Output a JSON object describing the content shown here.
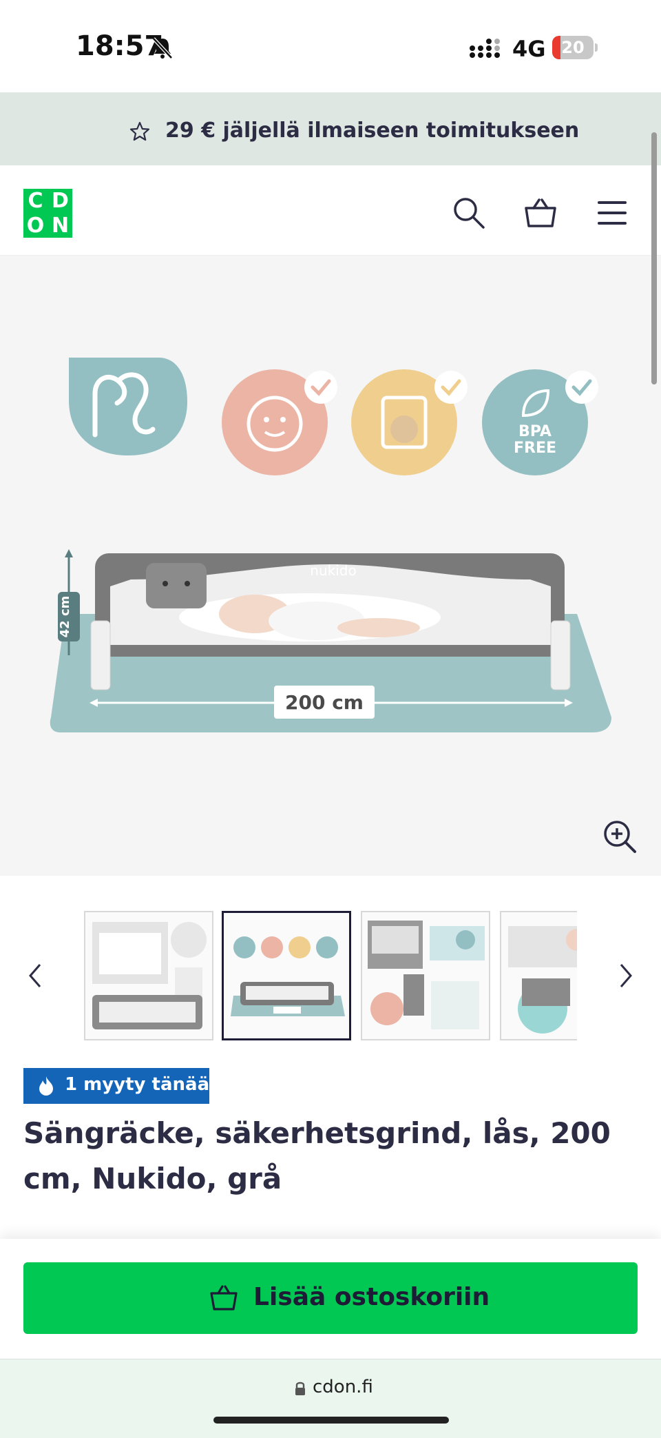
{
  "status_bar": {
    "time": "18:57",
    "network": "4G",
    "battery_level": "20",
    "battery_fraction": 0.2
  },
  "promo_banner": {
    "icon": "star-outline-icon",
    "text": "29 € jäljellä ilmaiseen toimitukseen"
  },
  "header": {
    "logo_letters": [
      "C",
      "D",
      "O",
      "N"
    ],
    "colors": {
      "brand": "#00c853",
      "banner": "#dfe7e2"
    },
    "icons": [
      "search-icon",
      "basket-icon",
      "hamburger-menu-icon"
    ]
  },
  "product_image": {
    "brand": "nukido",
    "height_label": "42 cm",
    "width_label": "200 cm",
    "badge_text_1": "BPA",
    "badge_text_2": "FREE"
  },
  "thumbnails": {
    "selected_index": 1,
    "count_visible": 4
  },
  "badge": {
    "icon": "fire-icon",
    "text": "1 myyty tänään",
    "color": "#1465b8"
  },
  "product": {
    "title": "Sängräcke, säkerhetsgrind, lås, 200 cm, Nukido, grå"
  },
  "cart": {
    "button_label": "Lisää ostoskoriin",
    "icon": "basket-icon"
  },
  "browser": {
    "url": "cdon.fi"
  }
}
